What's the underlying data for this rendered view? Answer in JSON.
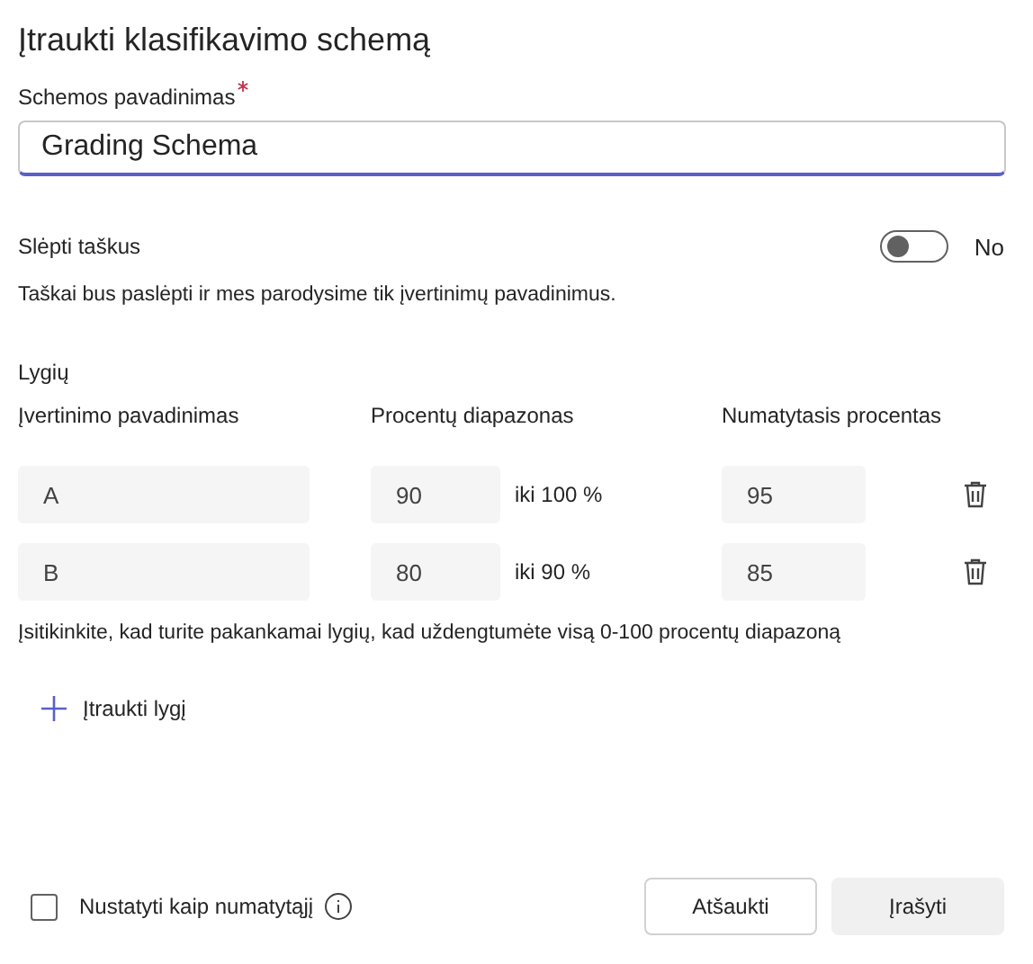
{
  "title": "Įtraukti klasifikavimo schemą",
  "name_field": {
    "label": "Schemos pavadinimas",
    "required": true,
    "value": "Grading Schema"
  },
  "hide_points": {
    "label": "Slėpti taškus",
    "on": false,
    "state_text": "No",
    "description": "Taškai bus paslėpti ir mes parodysime tik įvertinimų pavadinimus."
  },
  "levels": {
    "heading": "Lygių",
    "columns": [
      "Įvertinimo pavadinimas",
      "Procentų diapazonas",
      "Numatytasis procentas"
    ],
    "rows": [
      {
        "name": "A",
        "from": "90",
        "to": "iki 100 %",
        "default": "95"
      },
      {
        "name": "B",
        "from": "80",
        "to": "iki 90 %",
        "default": "85"
      }
    ],
    "note": "Įsitikinkite, kad turite pakankamai lygių, kad uždengtumėte visą 0-100 procentų diapazoną",
    "add": "Įtraukti lygį"
  },
  "footer": {
    "default_checkbox": {
      "label": "Nustatyti kaip numatytąjį",
      "checked": false
    },
    "buttons": [
      "Atšaukti",
      "Įrašyti"
    ]
  }
}
